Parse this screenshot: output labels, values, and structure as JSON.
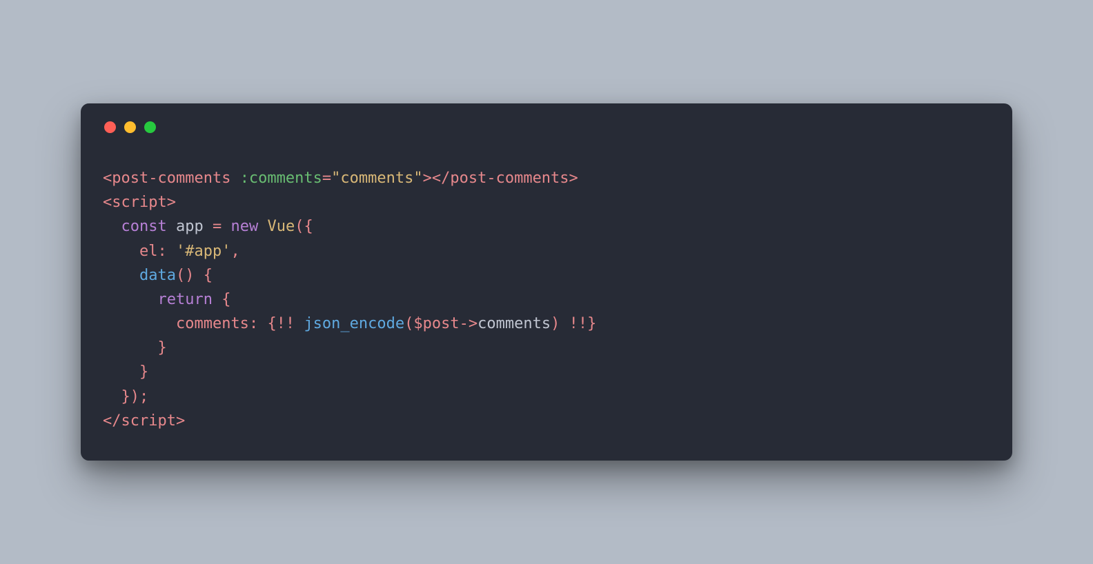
{
  "window": {
    "traffic_lights": {
      "red": "#ff5f56",
      "yellow": "#ffbd2e",
      "green": "#27c93f"
    }
  },
  "code": {
    "lines": [
      {
        "indent": 0,
        "tokens": [
          {
            "cls": "punct",
            "t": "<"
          },
          {
            "cls": "tag",
            "t": "post-comments"
          },
          {
            "cls": "ident",
            "t": " "
          },
          {
            "cls": "attr",
            "t": ":comments"
          },
          {
            "cls": "punct",
            "t": "="
          },
          {
            "cls": "str",
            "t": "\"comments\""
          },
          {
            "cls": "punct",
            "t": "></"
          },
          {
            "cls": "tag",
            "t": "post-comments"
          },
          {
            "cls": "punct",
            "t": ">"
          }
        ]
      },
      {
        "indent": 0,
        "tokens": [
          {
            "cls": "punct",
            "t": "<"
          },
          {
            "cls": "tag",
            "t": "script"
          },
          {
            "cls": "punct",
            "t": ">"
          }
        ]
      },
      {
        "indent": 2,
        "tokens": [
          {
            "cls": "kw",
            "t": "const"
          },
          {
            "cls": "ident",
            "t": " app "
          },
          {
            "cls": "punct",
            "t": "="
          },
          {
            "cls": "ident",
            "t": " "
          },
          {
            "cls": "kw",
            "t": "new"
          },
          {
            "cls": "ident",
            "t": " "
          },
          {
            "cls": "cls",
            "t": "Vue"
          },
          {
            "cls": "punct",
            "t": "({"
          }
        ]
      },
      {
        "indent": 4,
        "tokens": [
          {
            "cls": "prop",
            "t": "el"
          },
          {
            "cls": "punct",
            "t": ":"
          },
          {
            "cls": "ident",
            "t": " "
          },
          {
            "cls": "str",
            "t": "'#app'"
          },
          {
            "cls": "punct",
            "t": ","
          }
        ]
      },
      {
        "indent": 4,
        "tokens": [
          {
            "cls": "fn",
            "t": "data"
          },
          {
            "cls": "punct",
            "t": "()"
          },
          {
            "cls": "ident",
            "t": " "
          },
          {
            "cls": "punct",
            "t": "{"
          }
        ]
      },
      {
        "indent": 6,
        "tokens": [
          {
            "cls": "kw",
            "t": "return"
          },
          {
            "cls": "ident",
            "t": " "
          },
          {
            "cls": "punct",
            "t": "{"
          }
        ]
      },
      {
        "indent": 8,
        "tokens": [
          {
            "cls": "prop",
            "t": "comments"
          },
          {
            "cls": "punct",
            "t": ":"
          },
          {
            "cls": "ident",
            "t": " "
          },
          {
            "cls": "punct",
            "t": "{!!"
          },
          {
            "cls": "ident",
            "t": " "
          },
          {
            "cls": "fn",
            "t": "json_encode"
          },
          {
            "cls": "punct",
            "t": "("
          },
          {
            "cls": "var",
            "t": "$post"
          },
          {
            "cls": "punct",
            "t": "->"
          },
          {
            "cls": "member",
            "t": "comments"
          },
          {
            "cls": "punct",
            "t": ")"
          },
          {
            "cls": "ident",
            "t": " "
          },
          {
            "cls": "punct",
            "t": "!!}"
          }
        ]
      },
      {
        "indent": 6,
        "tokens": [
          {
            "cls": "punct",
            "t": "}"
          }
        ]
      },
      {
        "indent": 4,
        "tokens": [
          {
            "cls": "punct",
            "t": "}"
          }
        ]
      },
      {
        "indent": 2,
        "tokens": [
          {
            "cls": "punct",
            "t": "});"
          }
        ]
      },
      {
        "indent": 0,
        "tokens": [
          {
            "cls": "punct",
            "t": "</"
          },
          {
            "cls": "tag",
            "t": "script"
          },
          {
            "cls": "punct",
            "t": ">"
          }
        ]
      }
    ]
  }
}
